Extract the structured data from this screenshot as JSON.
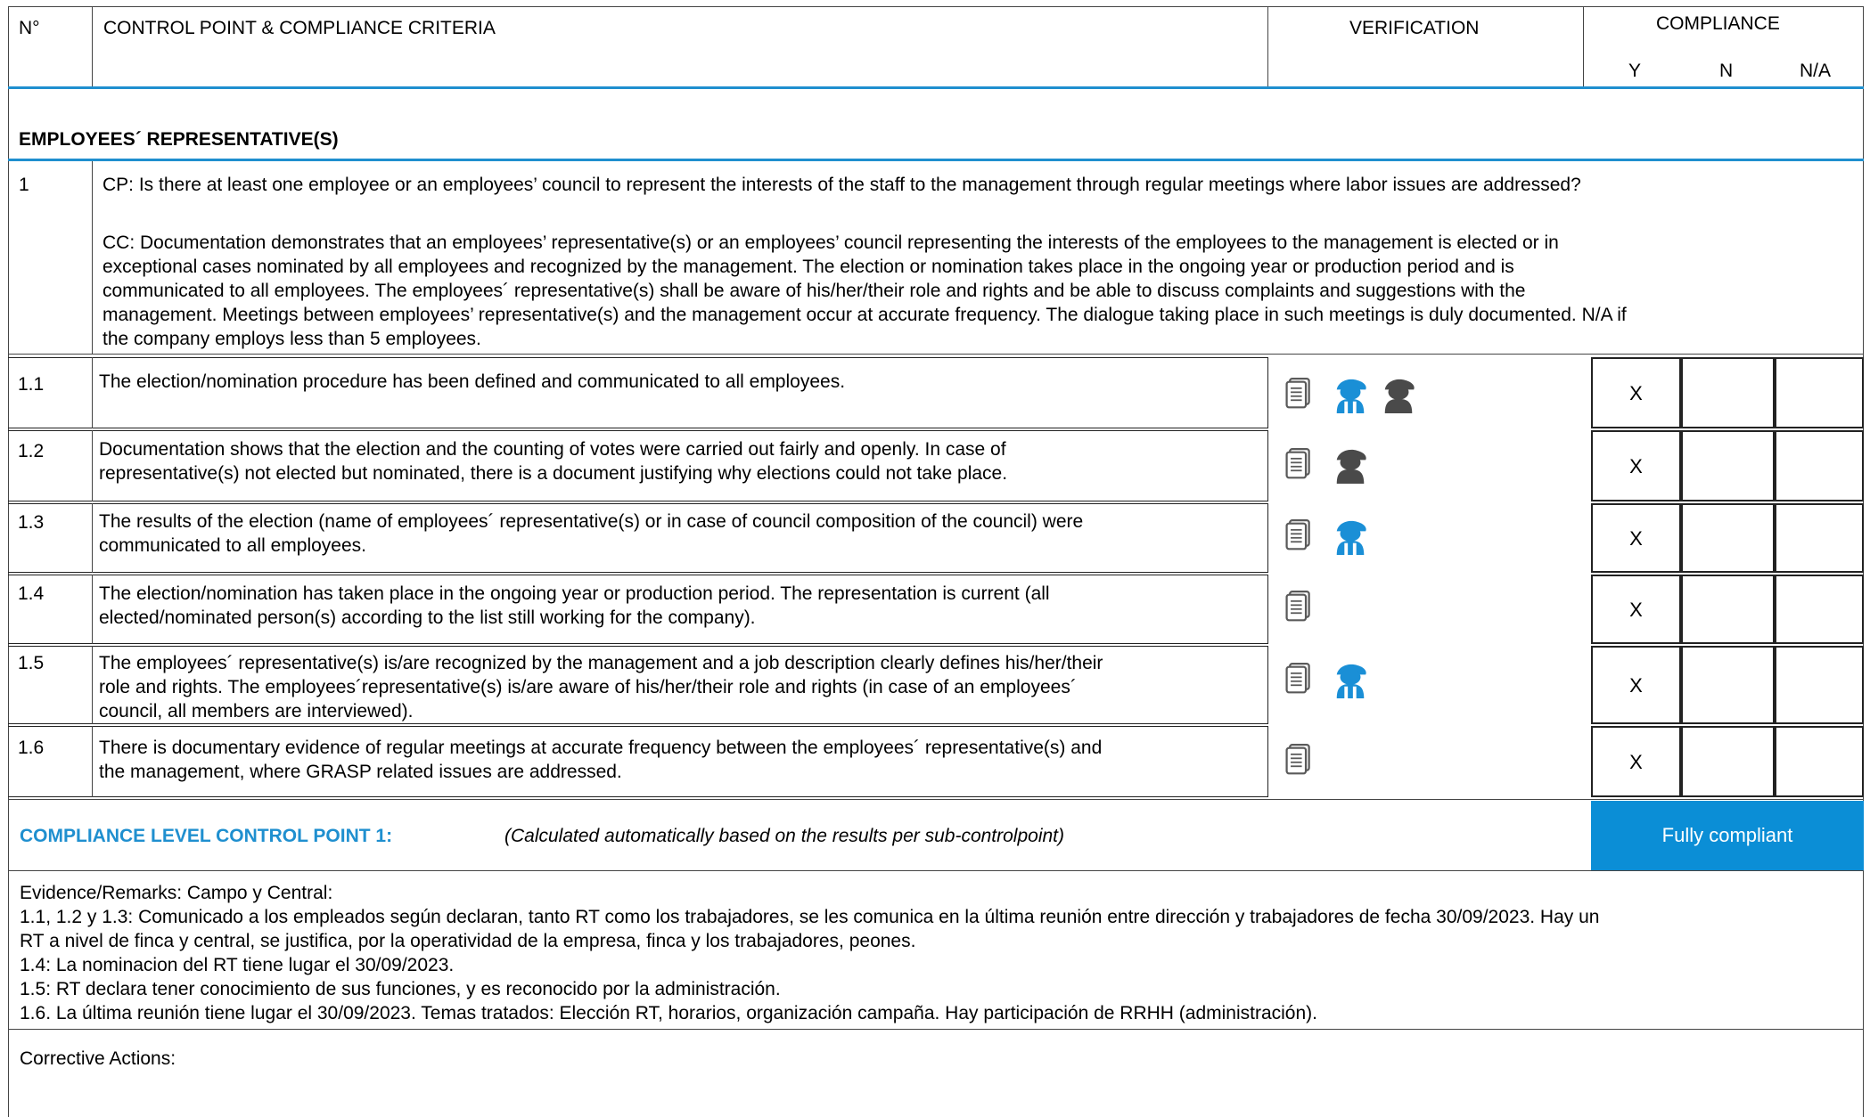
{
  "header": {
    "no": "N°",
    "control_point": "CONTROL POINT & COMPLIANCE CRITERIA",
    "verification": "VERIFICATION",
    "compliance": "COMPLIANCE",
    "y": "Y",
    "n": "N",
    "na": "N/A"
  },
  "section_title": "EMPLOYEES´ REPRESENTATIVE(S)",
  "cp": {
    "number": "1",
    "question": "CP: Is there at least one employee or an employees’ council to represent the interests of the staff to the management through regular meetings where labor issues are addressed?",
    "criteria_lines": [
      "CC: Documentation demonstrates that an employees’ representative(s) or an employees’ council representing the interests of the employees to the management is elected or in",
      "exceptional cases nominated by all employees and recognized by the management. The election or nomination takes place in the ongoing year or production period and is",
      "communicated to all employees. The employees´ representative(s) shall be aware of his/her/their role and rights and be able to discuss complaints and suggestions with the",
      "management. Meetings between employees’ representative(s) and the management occur at accurate frequency. The dialogue taking place in such meetings is duly documented. N/A if",
      "the company employs less than 5 employees."
    ]
  },
  "rows": [
    {
      "num": "1.1",
      "lines": [
        "The election/nomination procedure has been defined and communicated to all employees."
      ],
      "icons": [
        "document-icon",
        "worker-blue-icon",
        "worker-gray-icon"
      ],
      "y": "X",
      "n": "",
      "na": ""
    },
    {
      "num": "1.2",
      "lines": [
        "Documentation shows that the election and the counting of votes were carried out fairly and openly. In case of",
        "representative(s) not elected but nominated, there is a document justifying why elections could not take place."
      ],
      "icons": [
        "document-icon",
        "worker-gray-icon"
      ],
      "y": "X",
      "n": "",
      "na": ""
    },
    {
      "num": "1.3",
      "lines": [
        "The results of the election (name of employees´ representative(s) or in case of council composition of the council) were",
        "communicated to all employees."
      ],
      "icons": [
        "document-icon",
        "worker-blue-icon"
      ],
      "y": "X",
      "n": "",
      "na": ""
    },
    {
      "num": "1.4",
      "lines": [
        "The election/nomination has taken place in the ongoing year or production period. The representation is current (all",
        "elected/nominated person(s) according to the list still working for the company)."
      ],
      "icons": [
        "document-icon"
      ],
      "y": "X",
      "n": "",
      "na": ""
    },
    {
      "num": "1.5",
      "lines": [
        "The employees´ representative(s) is/are recognized by the management and a job description clearly defines his/her/their",
        "role and rights. The employees´representative(s) is/are aware of his/her/their role and rights (in case of an employees´",
        "council, all members are interviewed)."
      ],
      "icons": [
        "document-icon",
        "worker-blue-icon"
      ],
      "y": "X",
      "n": "",
      "na": ""
    },
    {
      "num": "1.6",
      "lines": [
        "There is documentary evidence of regular meetings at accurate frequency between the employees´ representative(s) and",
        "the management, where GRASP related issues are addressed."
      ],
      "icons": [
        "document-icon"
      ],
      "y": "X",
      "n": "",
      "na": ""
    }
  ],
  "compliance_level": {
    "label": "COMPLIANCE LEVEL CONTROL POINT 1:",
    "note": "(Calculated automatically based on the results per sub-controlpoint)",
    "result": "Fully compliant"
  },
  "evidence_lines": [
    "Evidence/Remarks: Campo y Central:",
    "1.1, 1.2 y 1.3: Comunicado a los empleados según declaran, tanto RT como los trabajadores, se les comunica en la última reunión entre dirección y trabajadores de fecha 30/09/2023. Hay un",
    "RT a nivel de finca y central, se justifica, por la operatividad de la empresa, finca y los trabajadores, peones.",
    "1.4: La nominacion del RT tiene lugar el 30/09/2023.",
    "1.5: RT declara tener conocimiento de sus funciones, y es reconocido por la administración.",
    "1.6. La última reunión tiene lugar el 30/09/2023. Temas tratados: Elección RT, horarios, organización campaña. Hay participación de RRHH (administración)."
  ],
  "corrective_actions": "Corrective Actions:",
  "colors": {
    "accent": "#1f8fcf",
    "result_bg": "#0b8ed6",
    "icon_gray": "#4a4a4a",
    "icon_blue": "#1a8fd6"
  }
}
